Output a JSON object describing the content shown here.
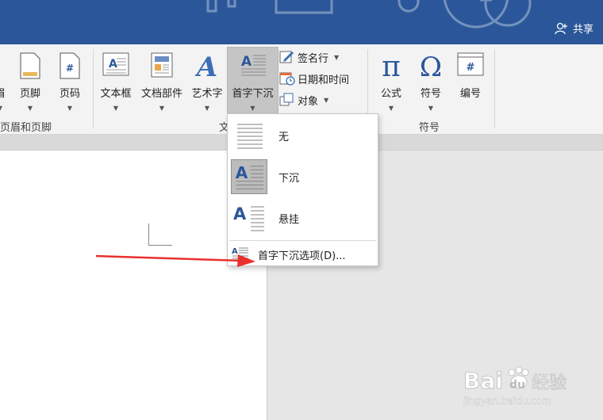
{
  "title_bar": {
    "share_label": "共享"
  },
  "ribbon": {
    "header_footer": {
      "partial_label": "眉",
      "footer_label": "页脚",
      "page_number_label": "页码",
      "group_label": "页眉和页脚"
    },
    "text": {
      "textbox_label": "文本框",
      "quick_parts_label": "文档部件",
      "wordart_label": "艺术字",
      "dropcap_label": "首字下沉",
      "signature_label": "签名行",
      "datetime_label": "日期和时间",
      "object_label": "对象",
      "group_label_partial": "文"
    },
    "symbols": {
      "equation_label": "公式",
      "symbol_label": "符号",
      "numbering_label": "编号",
      "group_label": "符号"
    }
  },
  "dropcap_menu": {
    "items": [
      {
        "label": "无",
        "selected": false
      },
      {
        "label": "下沉",
        "selected": true
      },
      {
        "label": "悬挂",
        "selected": false
      }
    ],
    "options_label": "首字下沉选项(D)..."
  },
  "watermark": {
    "brand": "Bai",
    "brand2": "du",
    "cn": "经验",
    "url": "jingyan.baidu.com"
  },
  "colors": {
    "accent": "#2b579a",
    "icon_blue": "#2b579a",
    "arrow": "#e8312f"
  }
}
